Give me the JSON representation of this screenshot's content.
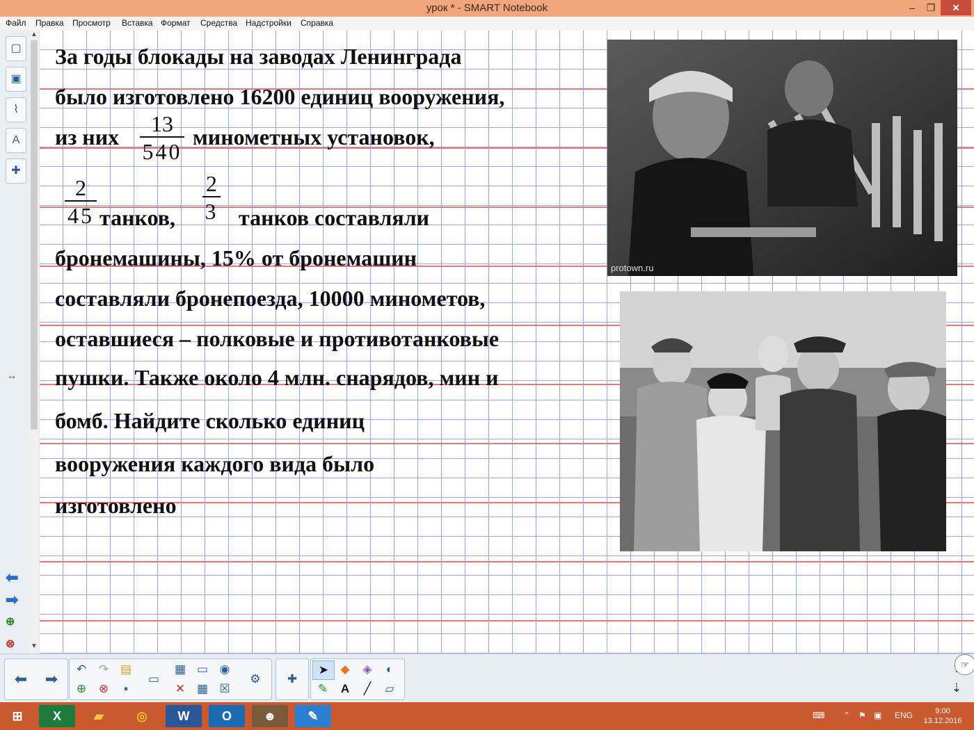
{
  "window": {
    "title": "урок * - SMART Notebook",
    "min_glyph": "–",
    "max_glyph": "❐",
    "close_glyph": "✕"
  },
  "menu": [
    "Файл",
    "Правка",
    "Просмотр",
    "Вставка",
    "Формат",
    "Средства",
    "Надстройки",
    "Справка"
  ],
  "sidebar_icons": [
    "page-sorter-icon",
    "gallery-icon",
    "attachments-icon",
    "properties-icon",
    "addons-icon"
  ],
  "page": {
    "lines": [
      "За годы блокады на заводах Ленинграда",
      "было изготовлено 16200 единиц вооружения,",
      "из них",
      "минометных установок,",
      "танков,",
      "танков составляли",
      "бронемашины, 15% от бронемашин",
      "составляли  бронепоезда, 10000 минометов,",
      "оставшиеся – полковые и противотанковые",
      "пушки. Также около 4 млн. снарядов, мин и",
      "бомб. Найдите сколько единиц",
      "вооружения каждого вида было",
      "изготовлено"
    ],
    "fractions": [
      {
        "num": "13",
        "den": "540"
      },
      {
        "num": "2",
        "den": "45"
      },
      {
        "num": "2",
        "den": "3"
      }
    ],
    "photo1_watermark": "protown.ru"
  },
  "tray": {
    "lang": "ENG",
    "time": "9:00",
    "date": "13.12.2016"
  },
  "colors": {
    "titlebar": "#f0a57a",
    "taskbar": "#c9592f",
    "grid_red": "#e3777a",
    "grid_blue": "#97a6e6"
  }
}
